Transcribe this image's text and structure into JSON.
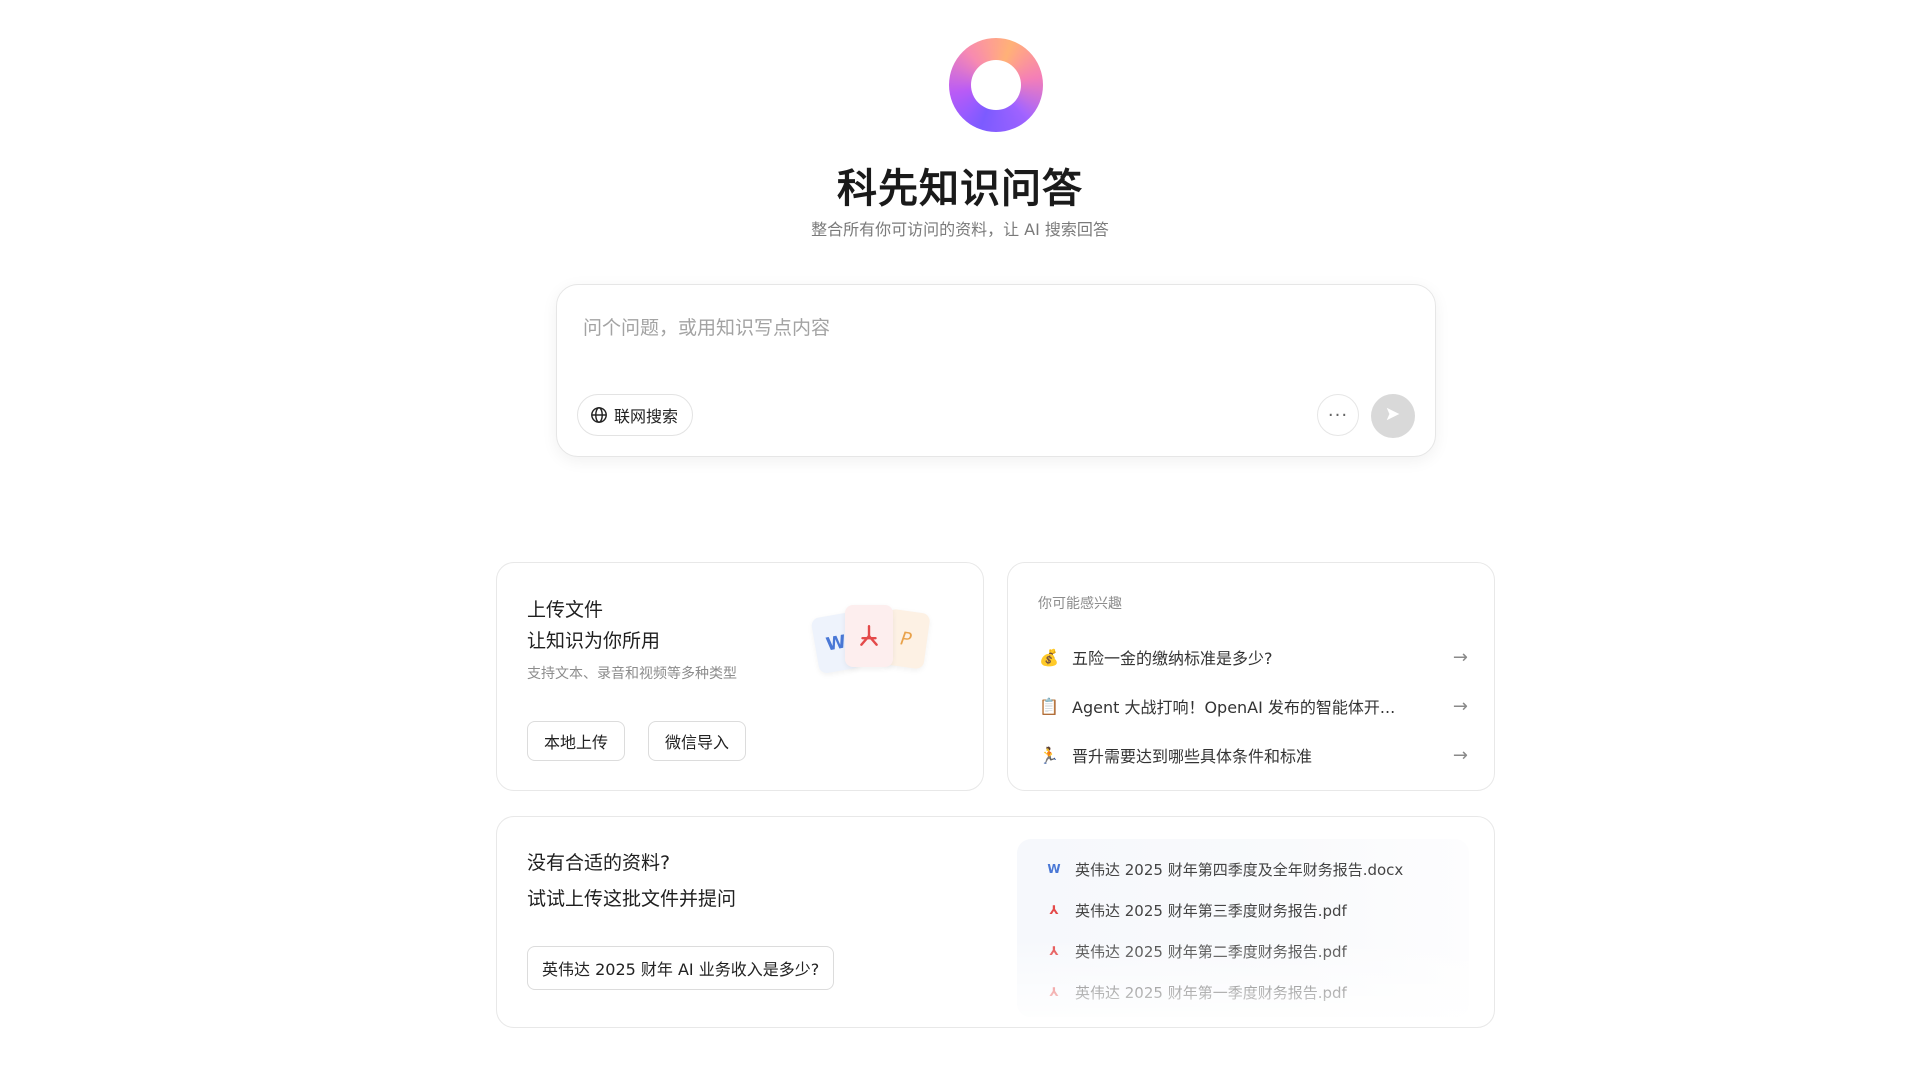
{
  "header": {
    "title": "科先知识问答",
    "subtitle": "整合所有你可访问的资料，让 AI 搜索回答"
  },
  "ask_box": {
    "placeholder": "问个问题，或用知识写点内容",
    "value": "",
    "web_search_label": "联网搜索",
    "more_label": "···"
  },
  "upload_card": {
    "title_line1": "上传文件",
    "title_line2": "让知识为你所用",
    "description": "支持文本、录音和视频等多种类型",
    "local_upload_label": "本地上传",
    "wechat_import_label": "微信导入",
    "doc_word_letter": "W",
    "doc_pdf_letter": "⅄",
    "doc_ppt_letter": "P"
  },
  "suggest_card": {
    "heading": "你可能感兴趣",
    "items": [
      {
        "emoji": "💰",
        "text": "五险一金的缴纳标准是多少?",
        "arrow": "→"
      },
      {
        "emoji": "📋",
        "text": "Agent 大战打响！OpenAI 发布的智能体开...",
        "arrow": "→"
      },
      {
        "emoji": "🏃",
        "text": "晋升需要达到哪些具体条件和标准",
        "arrow": "→"
      }
    ]
  },
  "sample_card": {
    "title_line1": "没有合适的资料?",
    "title_line2": "试试上传这批文件并提问",
    "question_label": "英伟达 2025 财年 AI 业务收入是多少?",
    "files": [
      {
        "type": "word",
        "icon": "W",
        "name": "英伟达 2025 财年第四季度及全年财务报告.docx"
      },
      {
        "type": "pdf",
        "icon": "⅄",
        "name": "英伟达 2025 财年第三季度财务报告.pdf"
      },
      {
        "type": "pdf",
        "icon": "⅄",
        "name": "英伟达 2025 财年第二季度财务报告.pdf"
      },
      {
        "type": "pdf",
        "icon": "⅄",
        "name": "英伟达 2025 财年第一季度财务报告.pdf"
      }
    ]
  },
  "colors": {
    "send_button_disabled": "#d9d9d9",
    "logo_gradient": [
      "#7b5cff",
      "#b65cf0",
      "#f38bb0",
      "#ffb27a"
    ]
  }
}
